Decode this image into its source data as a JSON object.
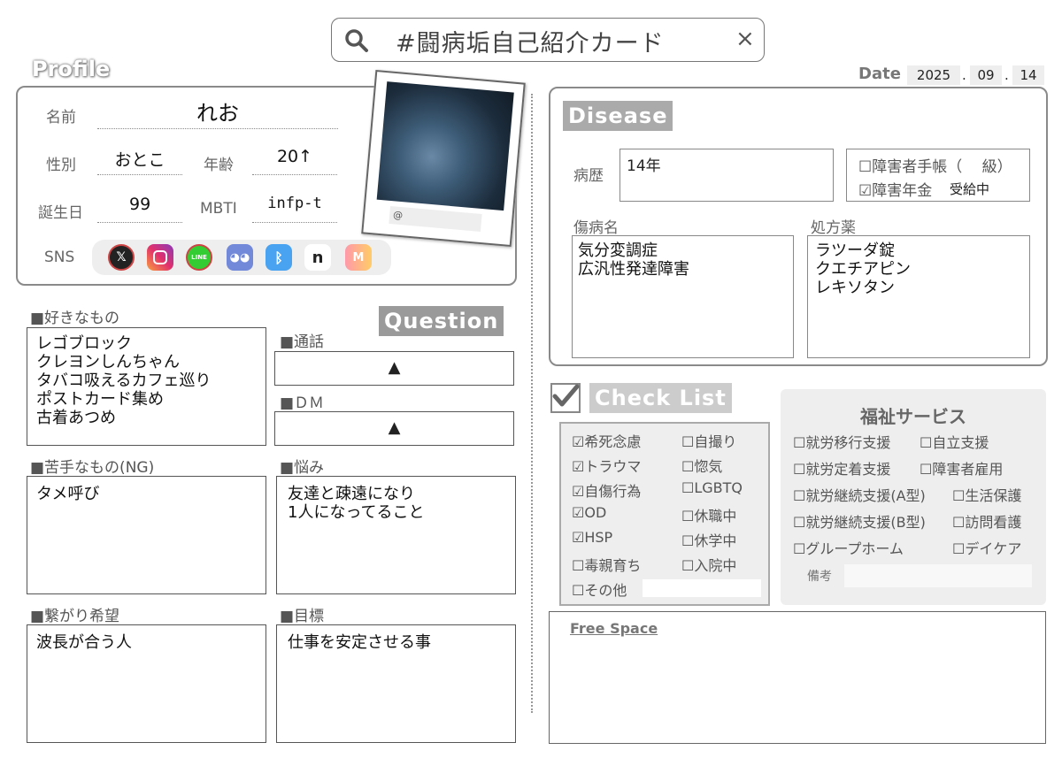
{
  "search": {
    "text": "#闘病垢自己紹介カード",
    "close_glyph": "×"
  },
  "date": {
    "label": "Date",
    "year": "2025",
    "month": "09",
    "day": "14",
    "sep": "."
  },
  "profile": {
    "title": "Profile",
    "name_label": "名前",
    "name_value": "れお",
    "gender_label": "性別",
    "gender_value": "おとこ",
    "age_label": "年齢",
    "age_value": "20↑",
    "birthday_label": "誕生日",
    "birthday_value": "99",
    "mbti_label": "MBTI",
    "mbti_value": "infp-t",
    "sns_label": "SNS",
    "sns_icons": [
      "x-icon",
      "instagram-icon",
      "line-icon",
      "discord-icon",
      "bluesky-icon",
      "note-icon",
      "misskey-icon"
    ],
    "photo_handle": "@"
  },
  "likes": {
    "label": "■好きなもの",
    "value": "レゴブロック\nクレヨンしんちゃん\nタバコ吸えるカフェ巡り\nポストカード集め\n古着あつめ"
  },
  "question": {
    "title": "Question"
  },
  "call": {
    "label": "■通話",
    "value": "▲"
  },
  "dm": {
    "label": "■ＤＭ",
    "value": "▲"
  },
  "dislikes": {
    "label": "■苦手なもの(NG)",
    "value": "タメ呼び"
  },
  "worries": {
    "label": "■悩み",
    "value": "友達と疎遠になり\n1人になってること"
  },
  "connect": {
    "label": "■繋がり希望",
    "value": "波長が合う人"
  },
  "goal": {
    "label": "■目標",
    "value": "仕事を安定させる事"
  },
  "disease": {
    "title": "Disease",
    "history_label": "病歴",
    "history_value": "14年",
    "handbook": "☐障害者手帳（　 級）",
    "pension": "☑障害年金",
    "pension_note": "受給中",
    "diagnosis_label": "傷病名",
    "diagnosis_value": "気分変調症\n広汎性発達障害",
    "meds_label": "処方薬",
    "meds_value": "ラツーダ錠\nクエチアピン\nレキソタン"
  },
  "checklist": {
    "title": "Check List",
    "left": [
      "☑希死念慮",
      "☑トラウマ",
      "☑自傷行為",
      "☑OD",
      "☑HSP",
      "☐毒親育ち",
      "☐その他"
    ],
    "right": [
      "☐自撮り",
      "☐惚気",
      "☐LGBTQ",
      "☐休職中",
      "☐休学中",
      "☐入院中"
    ]
  },
  "welfare": {
    "title": "福祉サービス",
    "left": [
      "☐就労移行支援",
      "☐就労定着支援",
      "☐就労継続支援(A型)",
      "☐就労継続支援(B型)",
      "☐グループホーム"
    ],
    "right": [
      "☐自立支援",
      "☐障害者雇用",
      "☐生活保護",
      "☐訪問看護",
      "☐デイケア"
    ],
    "note_label": "備考"
  },
  "free": {
    "label": "Free Space"
  },
  "colors": {
    "border": "#8a8a8a",
    "title_bg": "#9a9a9a",
    "panel_bg": "#eeeeee"
  }
}
